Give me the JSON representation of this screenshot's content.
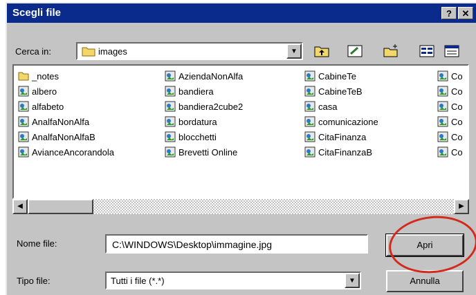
{
  "dialog": {
    "title": "Scegli file",
    "title_buttons": [
      "?",
      "✕"
    ]
  },
  "lookin": {
    "label": "Cerca in:",
    "value": "images"
  },
  "toolbar": [
    {
      "name": "up-one-level-icon"
    },
    {
      "name": "desktop-icon"
    },
    {
      "name": "new-folder-icon"
    },
    {
      "name": "list-view-icon"
    },
    {
      "name": "details-view-icon"
    }
  ],
  "files": {
    "col1": [
      "_notes",
      "albero",
      "alfabeto",
      "AnalfaNonAlfa",
      "AnalfaNonAlfaB",
      "AvianceAncorandola"
    ],
    "col2": [
      "AziendaNonAlfa",
      "bandiera",
      "bandiera2cube2",
      "bordatura",
      "blocchetti",
      "Brevetti Online"
    ],
    "col3": [
      "CabineTe",
      "CabineTeB",
      "casa",
      "comunicazione",
      "CitaFinanza",
      "CitaFinanzaB"
    ],
    "col4": [
      "Co",
      "Co",
      "Co",
      "Co",
      "Co",
      "Co"
    ]
  },
  "filename": {
    "label": "Nome file:",
    "value": "C:\\WINDOWS\\Desktop\\immagine.jpg"
  },
  "filetype": {
    "label": "Tipo file:",
    "value": "Tutti i file (*.*)"
  },
  "buttons": {
    "open": "Apri",
    "cancel": "Annulla"
  },
  "colors": {
    "titlebar": "#0a2a8c",
    "face": "#c4c4c4",
    "highlight_circle": "#d32a1e"
  }
}
